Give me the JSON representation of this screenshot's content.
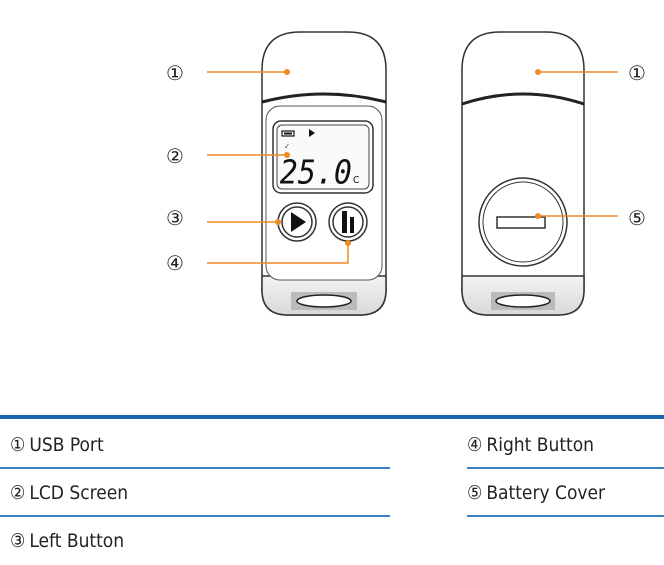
{
  "diagram": {
    "front_view": {
      "lcd": {
        "reading": "25.0",
        "unit": "C"
      },
      "callouts": [
        "①",
        "②",
        "③",
        "④"
      ]
    },
    "back_view": {
      "callouts": [
        "①",
        "⑤"
      ]
    },
    "colors": {
      "leader_line": "#f08a24",
      "legend_rule": "#1a67b1",
      "underline": "#3a7fc1"
    }
  },
  "legend": {
    "items": [
      {
        "num": "①",
        "label": "USB Port"
      },
      {
        "num": "②",
        "label": "LCD Screen"
      },
      {
        "num": "③",
        "label": "Left Button"
      },
      {
        "num": "④",
        "label": "Right Button"
      },
      {
        "num": "⑤",
        "label": "Battery Cover"
      }
    ]
  }
}
